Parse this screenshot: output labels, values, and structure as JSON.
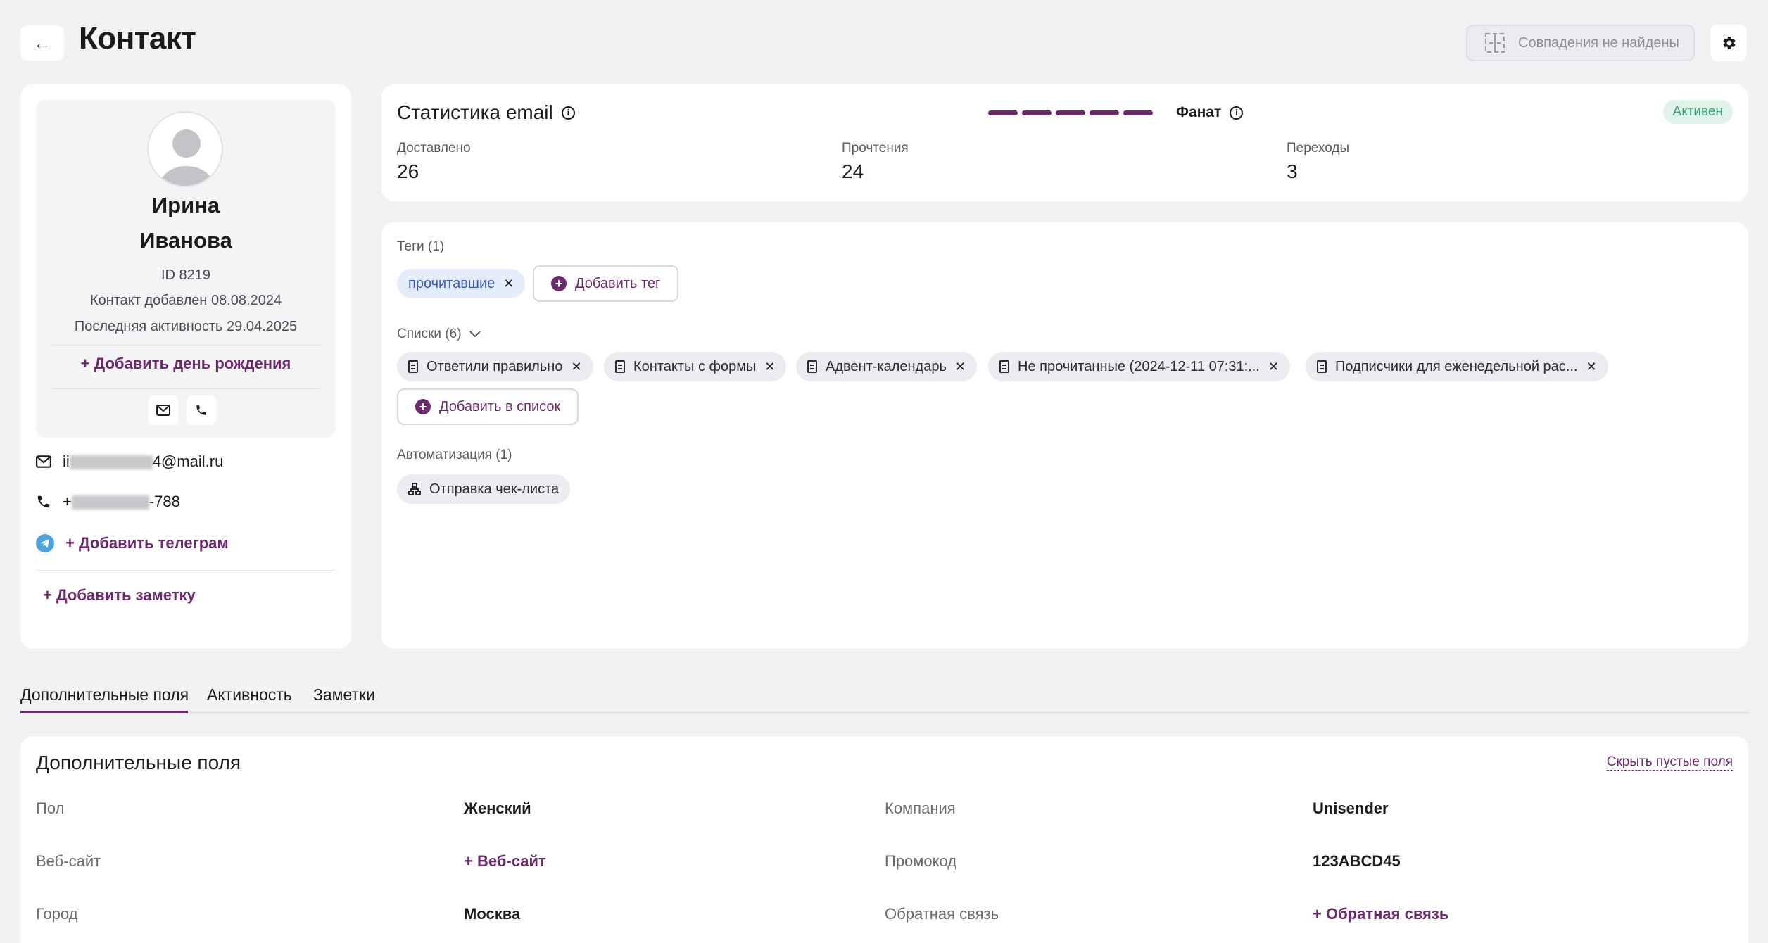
{
  "header": {
    "back_icon": "arrow-left-icon",
    "title": "Контакт",
    "duplicates_label": "Совпадения не найдены",
    "settings_icon": "gear-icon"
  },
  "profile": {
    "first_name": "Ирина",
    "last_name": "Иванова",
    "id_text": "ID 8219",
    "added_text": "Контакт добавлен 08.08.2024",
    "activity_text": "Последняя активность 29.04.2025",
    "add_birthday": "+ Добавить день рождения",
    "email_prefix": "ii",
    "email_suffix": "4@mail.ru",
    "phone_prefix": "+",
    "phone_suffix": "-788",
    "add_telegram": "+ Добавить телеграм",
    "add_note": "+ Добавить заметку"
  },
  "stats": {
    "title": "Статистика email",
    "level_label": "Фанат",
    "level_filled": 5,
    "level_total": 5,
    "status": "Активен",
    "delivered_label": "Доставлено",
    "delivered_value": "26",
    "opens_label": "Прочтения",
    "opens_value": "24",
    "clicks_label": "Переходы",
    "clicks_value": "3"
  },
  "tags": {
    "label": "Теги (1)",
    "items": [
      "прочитавшие"
    ],
    "add_label": "Добавить тег"
  },
  "lists": {
    "label": "Списки (6)",
    "items": [
      "Ответили правильно",
      "Контакты с формы",
      "Адвент-календарь",
      "Не прочитанные (2024-12-11 07:31:...",
      "Подписчики для еженедельной рас..."
    ],
    "add_label": "Добавить в список"
  },
  "automation": {
    "label": "Автоматизация (1)",
    "items": [
      "Отправка чек-листа"
    ]
  },
  "tabs": [
    "Дополнительные поля",
    "Активность",
    "Заметки"
  ],
  "fields": {
    "title": "Дополнительные поля",
    "hide_empty": "Скрыть пустые поля",
    "rows": [
      {
        "label_left": "Пол",
        "value_left": "Женский",
        "label_right": "Компания",
        "value_right": "Unisender"
      },
      {
        "label_left": "Веб-сайт",
        "value_left": "+ Веб-сайт",
        "label_right": "Промокод",
        "value_right": "123ABCD45"
      },
      {
        "label_left": "Город",
        "value_left": "Москва",
        "label_right": "Обратная связь",
        "value_right": "+ Обратная связь"
      }
    ]
  },
  "colors": {
    "accent": "#6b2a6b",
    "status_green": "#3aa57a",
    "tag_blue": "#3a5ab8",
    "background": "#f2f2f5"
  }
}
